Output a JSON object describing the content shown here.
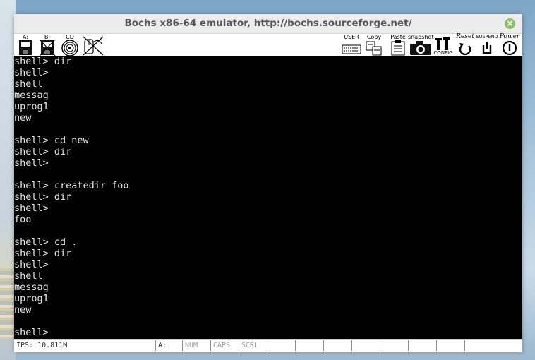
{
  "window": {
    "title": "Bochs x86-64 emulator, http://bochs.sourceforge.net/",
    "close_glyph": "×"
  },
  "toolbar": {
    "floppy_a_label": "A:",
    "floppy_b_label": "B:",
    "cdrom_label": "CD",
    "user_label": "USER",
    "copy_label": "Copy",
    "paste_label": "Paste",
    "snapshot_label": "snapshot",
    "config_label": "CONFIG",
    "reset_label": "Reset",
    "suspend_label": "SUSPEND",
    "power_label": "Power"
  },
  "terminal": {
    "lines": [
      "shell> dir",
      "shell>",
      "shell",
      "messag",
      "uprog1",
      "new",
      "",
      "shell> cd new",
      "shell> dir",
      "shell>",
      "",
      "shell> createdir foo",
      "shell> dir",
      "shell>",
      "foo",
      "",
      "shell> cd .",
      "shell> dir",
      "shell>",
      "shell",
      "messag",
      "uprog1",
      "new",
      "",
      "shell>"
    ]
  },
  "statusbar": {
    "ips": "IPS: 10.811M",
    "drive": "A:",
    "num": "NUM",
    "caps": "CAPS",
    "scrl": "SCRL"
  },
  "colors": {
    "screen_bg": "#000000",
    "screen_fg": "#e6e6e6",
    "close_button": "#8fc06a"
  }
}
